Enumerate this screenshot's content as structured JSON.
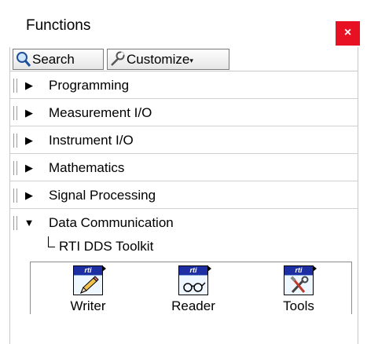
{
  "window": {
    "title": "Functions",
    "close_glyph": "×"
  },
  "toolbar": {
    "search_label": "Search",
    "customize_label": "Customize",
    "customize_caret": "▾"
  },
  "categories": [
    {
      "label": "Programming",
      "expanded": false,
      "arrow": "▶"
    },
    {
      "label": "Measurement I/O",
      "expanded": false,
      "arrow": "▶"
    },
    {
      "label": "Instrument I/O",
      "expanded": false,
      "arrow": "▶"
    },
    {
      "label": "Mathematics",
      "expanded": false,
      "arrow": "▶"
    },
    {
      "label": "Signal Processing",
      "expanded": false,
      "arrow": "▶"
    },
    {
      "label": "Data Communication",
      "expanded": true,
      "arrow": "▼"
    }
  ],
  "subpalette": {
    "label": "RTI DDS Toolkit",
    "items": [
      {
        "label": "Writer",
        "badge": "rti",
        "icon": "pencil-icon"
      },
      {
        "label": "Reader",
        "badge": "rti",
        "icon": "glasses-icon"
      },
      {
        "label": "Tools",
        "badge": "rti",
        "icon": "tools-icon"
      }
    ]
  },
  "colors": {
    "close": "#e81123",
    "vi_header": "#1d2fa3"
  }
}
